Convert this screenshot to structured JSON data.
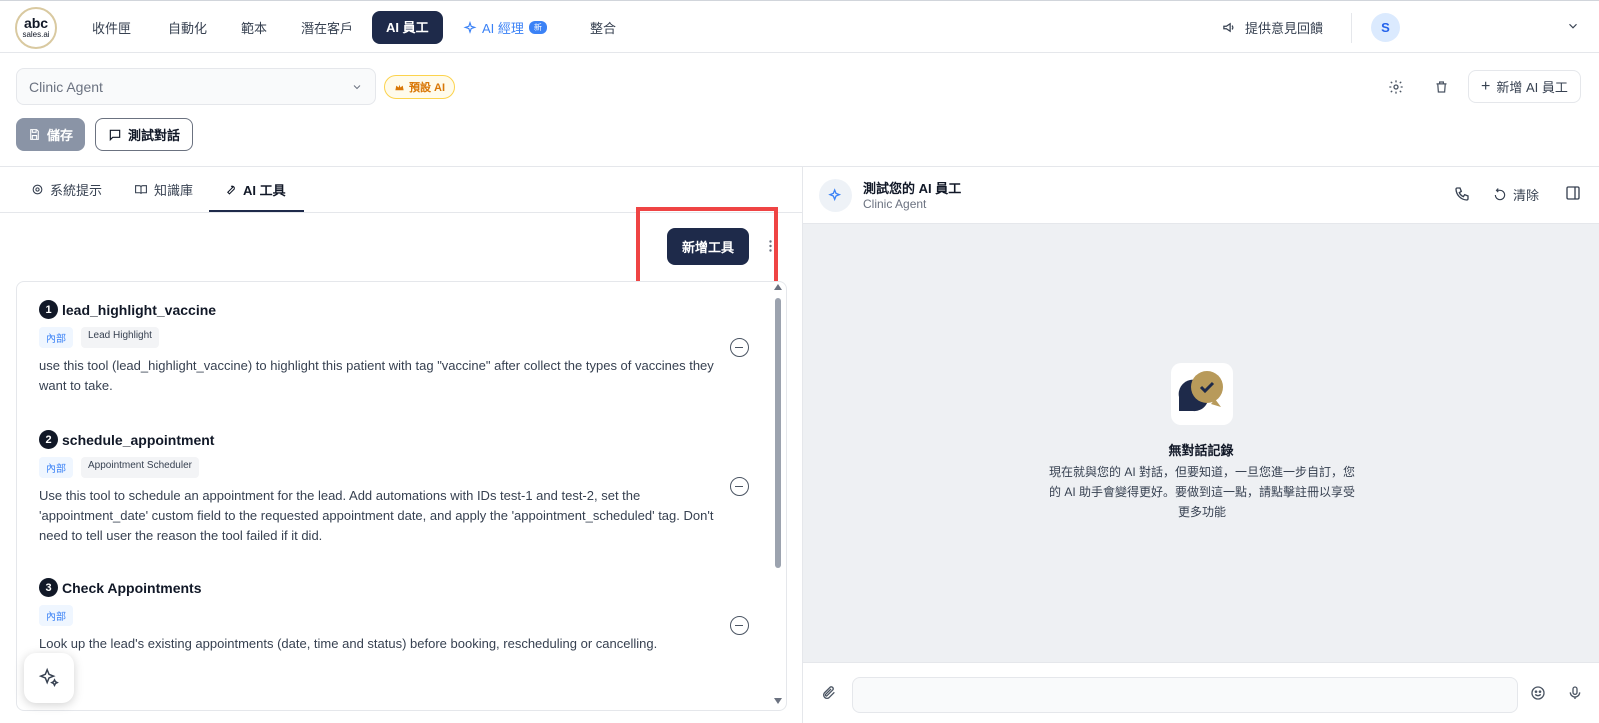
{
  "logo": {
    "line1": "abc",
    "line2": "sales.ai"
  },
  "nav": {
    "items": [
      "收件匣",
      "自動化",
      "範本",
      "潛在客戶",
      "AI 員工",
      "AI 經理",
      "整合"
    ],
    "new_badge": "新",
    "feedback": "提供意見回饋",
    "avatar": "S"
  },
  "agent": {
    "selected": "Clinic Agent",
    "default_badge": "預設 AI",
    "new_agent": "新增 AI 員工",
    "save": "儲存",
    "test_chat": "測試對話"
  },
  "tabs": [
    "系統提示",
    "知識庫",
    "AI 工具"
  ],
  "add_tool": "新增工具",
  "tools": [
    {
      "num": "1",
      "name": "lead_highlight_vaccine",
      "tag_type": "內部",
      "tag": "Lead Highlight",
      "desc": "use this tool (lead_highlight_vaccine) to highlight this patient with tag \"vaccine\" after collect the types of vaccines they want to take."
    },
    {
      "num": "2",
      "name": "schedule_appointment",
      "tag_type": "內部",
      "tag": "Appointment Scheduler",
      "desc": "Use this tool to schedule an appointment for the lead. Add automations with IDs test-1 and test-2, set the 'appointment_date' custom field to the requested appointment date, and apply the 'appointment_scheduled' tag. Don't need to tell user the reason the tool failed if it did."
    },
    {
      "num": "3",
      "name": "Check Appointments",
      "tag_type": "內部",
      "tag": "",
      "desc": "Look up the lead's existing appointments (date, time and status) before booking, rescheduling or cancelling."
    }
  ],
  "chat": {
    "title": "測試您的 AI 員工",
    "subtitle": "Clinic Agent",
    "clear": "清除",
    "empty_title": "無對話記錄",
    "empty_text": "現在就與您的 AI 對話，但要知道，一旦您進一步自訂，您的 AI 助手會變得更好。要做到這一點，請點擊註冊以享受更多功能"
  },
  "colors": {
    "primary": "#1e2a4a",
    "accent": "#3b82f6",
    "highlight": "#ef4444",
    "gold": "#b89a5a"
  }
}
